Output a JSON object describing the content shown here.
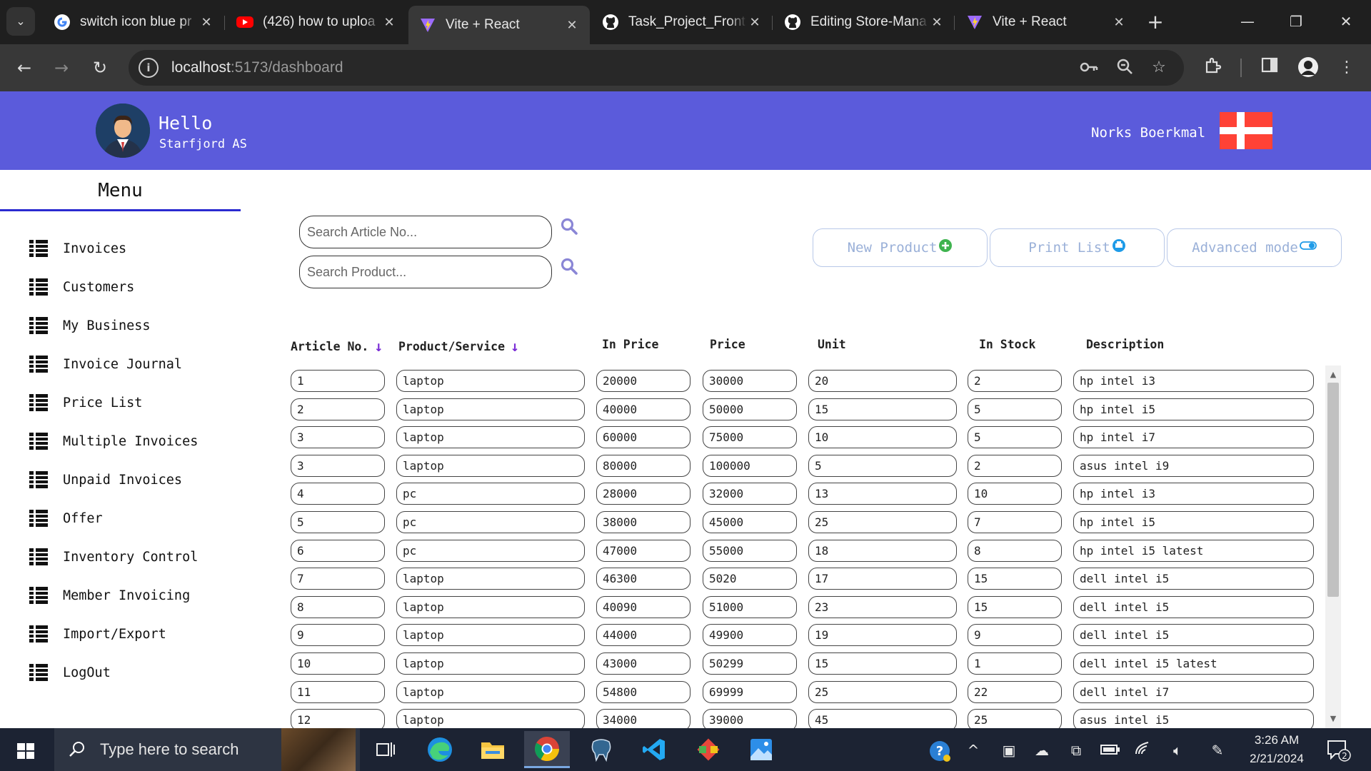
{
  "browser": {
    "tabs": [
      {
        "title": "switch icon blue pr",
        "favicon": "google-icon"
      },
      {
        "title": "(426) how to uploa",
        "favicon": "youtube-icon"
      },
      {
        "title": "Vite + React",
        "favicon": "vite-icon",
        "active": true
      },
      {
        "title": "Task_Project_Front",
        "favicon": "github-icon"
      },
      {
        "title": "Editing Store-Mana",
        "favicon": "github-icon"
      },
      {
        "title": "Vite + React",
        "favicon": "vite-icon"
      }
    ],
    "close_glyph": "✕",
    "url_host": "localhost",
    "url_path": ":5173/dashboard"
  },
  "header": {
    "greeting": "Hello",
    "company": "Starfjord AS",
    "language": "Norks Boerkmal",
    "flag_colors": {
      "red": "#ff4236",
      "white": "#ffffff"
    },
    "bg_color": "#5b5bdb"
  },
  "menu": {
    "title": "Menu",
    "items": [
      "Invoices",
      "Customers",
      "My Business",
      "Invoice Journal",
      "Price List",
      "Multiple Invoices",
      "Unpaid Invoices",
      "Offer",
      "Inventory Control",
      "Member Invoicing",
      "Import/Export",
      "LogOut"
    ]
  },
  "search": {
    "article_placeholder": "Search Article No...",
    "product_placeholder": "Search Product..."
  },
  "actions": {
    "new_product": "New Product",
    "print_list": "Print List",
    "advanced_mode": "Advanced mode"
  },
  "table": {
    "headers": [
      "Article No.",
      "Product/Service",
      "In Price",
      "Price",
      "Unit",
      "In Stock",
      "Description"
    ],
    "sortable": [
      true,
      true,
      false,
      false,
      false,
      false,
      false
    ],
    "rows": [
      [
        "1",
        "laptop",
        "20000",
        "30000",
        "20",
        "2",
        "hp intel i3"
      ],
      [
        "2",
        "laptop",
        "40000",
        "50000",
        "15",
        "5",
        "hp intel i5"
      ],
      [
        "3",
        "laptop",
        "60000",
        "75000",
        "10",
        "5",
        "hp intel i7"
      ],
      [
        "3",
        "laptop",
        "80000",
        "100000",
        "5",
        "2",
        "asus intel i9"
      ],
      [
        "4",
        "pc",
        "28000",
        "32000",
        "13",
        "10",
        "hp intel i3"
      ],
      [
        "5",
        "pc",
        "38000",
        "45000",
        "25",
        "7",
        "hp intel i5"
      ],
      [
        "6",
        "pc",
        "47000",
        "55000",
        "18",
        "8",
        "hp intel i5 latest"
      ],
      [
        "7",
        "laptop",
        "46300",
        "5020",
        "17",
        "15",
        "dell intel i5"
      ],
      [
        "8",
        "laptop",
        "40090",
        "51000",
        "23",
        "15",
        "dell intel i5"
      ],
      [
        "9",
        "laptop",
        "44000",
        "49900",
        "19",
        "9",
        "dell intel i5"
      ],
      [
        "10",
        "laptop",
        "43000",
        "50299",
        "15",
        "1",
        "dell intel i5 latest"
      ],
      [
        "11",
        "laptop",
        "54800",
        "69999",
        "25",
        "22",
        "dell intel i7"
      ],
      [
        "12",
        "laptop",
        "34000",
        "39000",
        "45",
        "25",
        "asus intel i5"
      ]
    ]
  },
  "taskbar": {
    "search_placeholder": "Type here to search",
    "time": "3:26 AM",
    "date": "2/21/2024",
    "notification_count": "2"
  }
}
